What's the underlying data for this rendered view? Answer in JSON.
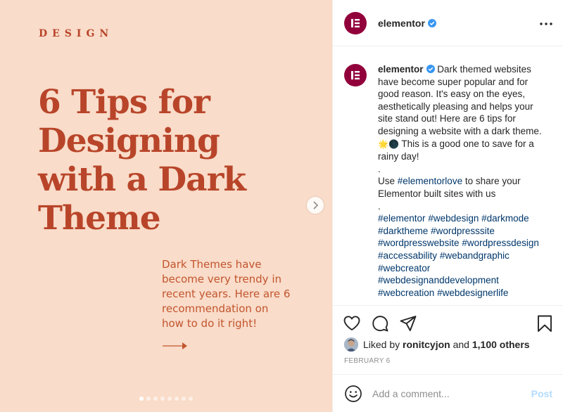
{
  "slide": {
    "category": "DESIGN",
    "title_lines": [
      "6 Tips for",
      "Designing",
      "with a Dark",
      "Theme"
    ],
    "subtitle_lines": [
      "Dark Themes have",
      "become very trendy in",
      "recent years. Here are 6",
      "recommendation on",
      "how to do it right!"
    ],
    "background_color": "#f9dcc9",
    "accent_color": "#b8452a",
    "arrow_icon": "arrow-right-icon",
    "next_icon": "chevron-right-icon",
    "dots_total": 8,
    "dots_active": 0
  },
  "post": {
    "brand_color": "#92003b",
    "header": {
      "username": "elementor",
      "verified": true,
      "more_icon": "more-horizontal-icon"
    },
    "caption": {
      "username": "elementor",
      "text_1": "Dark themed websites have become super popular and for good reason. It's easy on the eyes, aesthetically pleasing and helps your site stand out! Here are 6 tips for designing a website with a dark theme. ",
      "emoji": "🌟🌑",
      "text_2": " This is a good one to save for a rainy day!",
      "dot_1": ".",
      "use_prefix": "Use ",
      "use_hashtag": "#elementorlove",
      "use_suffix": " to share your Elementor built sites with us",
      "dot_2": ".",
      "hashtags": [
        "#elementor",
        "#webdesign",
        "#darkmode",
        "#darktheme",
        "#wordpresssite",
        "#wordpresswebsite",
        "#wordpressdesign",
        "#accessability",
        "#webandgraphic",
        "#webcreator",
        "#webdesignanddevelopment",
        "#webcreation",
        "#webdesignerlife"
      ]
    },
    "actions": {
      "like_icon": "heart-icon",
      "comment_icon": "comment-icon",
      "share_icon": "share-icon",
      "save_icon": "bookmark-icon"
    },
    "likes": {
      "prefix": "Liked by",
      "user": "ronitcyjon",
      "and": "and",
      "count": "1,100 others"
    },
    "date": "FEBRUARY 6",
    "comment": {
      "emoji_icon": "smiley-icon",
      "placeholder": "Add a comment...",
      "post_label": "Post"
    }
  }
}
